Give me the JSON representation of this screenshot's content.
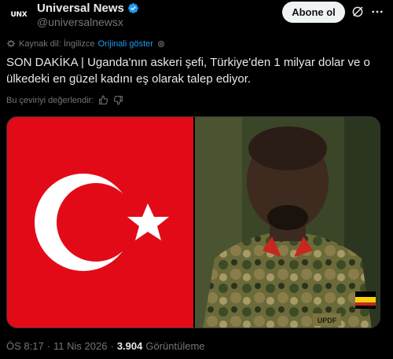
{
  "header": {
    "avatar_text": "UNX",
    "display_name": "Universal News",
    "handle": "@universalnewsx",
    "follow_label": "Abone ol"
  },
  "translation": {
    "source_label": "Kaynak dil: İngilizce",
    "show_original_label": "Orijinali göster"
  },
  "tweet": {
    "text": "SON DAKİKA | Uganda'nın askeri şefi, Türkiye'den 1 milyar dolar ve o ülkedeki en güzel kadını eş olarak talep ediyor."
  },
  "rating": {
    "label": "Bu çeviriyi değerlendir:"
  },
  "media": {
    "photo_badge_text": "UPDF"
  },
  "footer": {
    "time": "ÖS 8:17",
    "separator": "·",
    "date": "11 Nis 2026",
    "separator2": "·",
    "views": "3.904",
    "views_label": "Görüntüleme"
  },
  "colors": {
    "accent": "#1d9bf0",
    "flag_red": "#e30a17",
    "follow_bg": "#eff3f4"
  }
}
